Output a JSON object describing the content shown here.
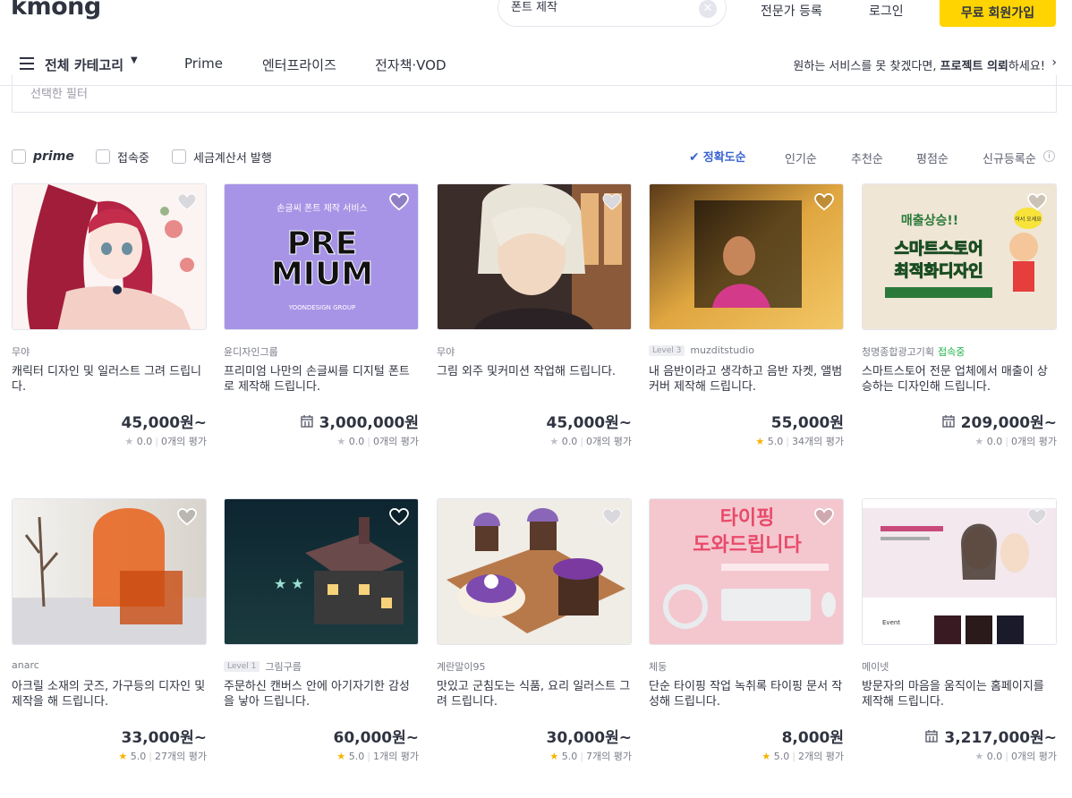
{
  "header": {
    "logo": "kmong",
    "search_value": "폰트 제작",
    "expert_register": "전문가 등록",
    "login": "로그인",
    "signup": "무료 회원가입"
  },
  "nav": {
    "all_categories": "전체 카테고리",
    "items": [
      "Prime",
      "엔터프라이즈",
      "전자책·VOD"
    ],
    "right_prefix": "원하는 서비스를 못 찾겠다면, ",
    "right_bold": "프로젝트 의뢰",
    "right_suffix": "하세요!"
  },
  "filters": {
    "selected_label": "선택한 필터",
    "options": [
      "prime",
      "접속중",
      "세금계산서 발행"
    ],
    "sorts": [
      "정확도순",
      "인기순",
      "추천순",
      "평점순",
      "신규등록순"
    ]
  },
  "colors": {
    "brand_yellow": "#ffd400",
    "sort_active": "#3a64d0",
    "online_green": "#20b447",
    "star": "#f5b301"
  },
  "cards": [
    {
      "seller": "무야",
      "level": "",
      "online": "",
      "title": "캐릭터 디자인 및 일러스트 그려 드립니다.",
      "price": "45,000원~",
      "enterprise": false,
      "rating": "0.0",
      "reviews": "0개의 평가",
      "star_on": false,
      "heart_style": "gray"
    },
    {
      "seller": "윤디자인그룹",
      "level": "",
      "online": "",
      "title": "프리미엄 나만의 손글씨를 디지털 폰트로 제작해 드립니다.",
      "price": "3,000,000원",
      "enterprise": true,
      "rating": "0.0",
      "reviews": "0개의 평가",
      "star_on": false,
      "heart_style": "white",
      "thumb_line1": "손글씨 폰트 제작 서비스",
      "thumb_line2": "PRE",
      "thumb_line3": "MIUM",
      "thumb_line4": "YOONDESIGN GROUP"
    },
    {
      "seller": "무야",
      "level": "",
      "online": "",
      "title": "그림 외주 및커미션 작업해 드립니다.",
      "price": "45,000원~",
      "enterprise": false,
      "rating": "0.0",
      "reviews": "0개의 평가",
      "star_on": false,
      "heart_style": "gray"
    },
    {
      "seller": "muzditstudio",
      "level": "Level 3",
      "online": "",
      "title": "내 음반이라고 생각하고 음반 자켓, 앨범 커버 제작해 드립니다.",
      "price": "55,000원",
      "enterprise": false,
      "rating": "5.0",
      "reviews": "34개의 평가",
      "star_on": true,
      "heart_style": "white"
    },
    {
      "seller": "청명종합광고기획",
      "level": "",
      "online": "접속중",
      "title": "스마트스토어 전문 업체에서 매출이 상승하는 디자인해 드립니다.",
      "price": "209,000원~",
      "enterprise": true,
      "rating": "0.0",
      "reviews": "0개의 평가",
      "star_on": false,
      "heart_style": "white",
      "thumb_line1": "매출상승!!",
      "thumb_line2": "스마트스토어",
      "thumb_line3": "최적화디자인",
      "thumb_line4": "어서 오세요"
    },
    {
      "seller": "anarc",
      "level": "",
      "online": "",
      "title": "아크릴 소재의 굿즈, 가구등의 디자인 및 제작을 해 드립니다.",
      "price": "33,000원~",
      "enterprise": false,
      "rating": "5.0",
      "reviews": "27개의 평가",
      "star_on": true,
      "heart_style": "white"
    },
    {
      "seller": "그림구름",
      "level": "Level 1",
      "online": "",
      "title": "주문하신 캔버스 안에 아기자기한 감성을 낳아 드립니다.",
      "price": "60,000원~",
      "enterprise": false,
      "rating": "5.0",
      "reviews": "1개의 평가",
      "star_on": true,
      "heart_style": "white"
    },
    {
      "seller": "계란말이95",
      "level": "",
      "online": "",
      "title": "맛있고 군침도는 식품, 요리 일러스트 그려 드립니다.",
      "price": "30,000원~",
      "enterprise": false,
      "rating": "5.0",
      "reviews": "7개의 평가",
      "star_on": true,
      "heart_style": "gray"
    },
    {
      "seller": "체둥",
      "level": "",
      "online": "",
      "title": "단순 타이핑 작업 녹취록 타이핑 문서 작성해 드립니다.",
      "price": "8,000원",
      "enterprise": false,
      "rating": "5.0",
      "reviews": "2개의 평가",
      "star_on": true,
      "heart_style": "white",
      "thumb_line1": "타이핑",
      "thumb_line2": "도와드립니다"
    },
    {
      "seller": "메이넷",
      "level": "",
      "online": "",
      "title": "방문자의 마음을 움직이는 홈페이지를 제작해 드립니다.",
      "price": "3,217,000원~",
      "enterprise": true,
      "rating": "0.0",
      "reviews": "0개의 평가",
      "star_on": false,
      "heart_style": "gray",
      "thumb_line1": "Event"
    }
  ]
}
